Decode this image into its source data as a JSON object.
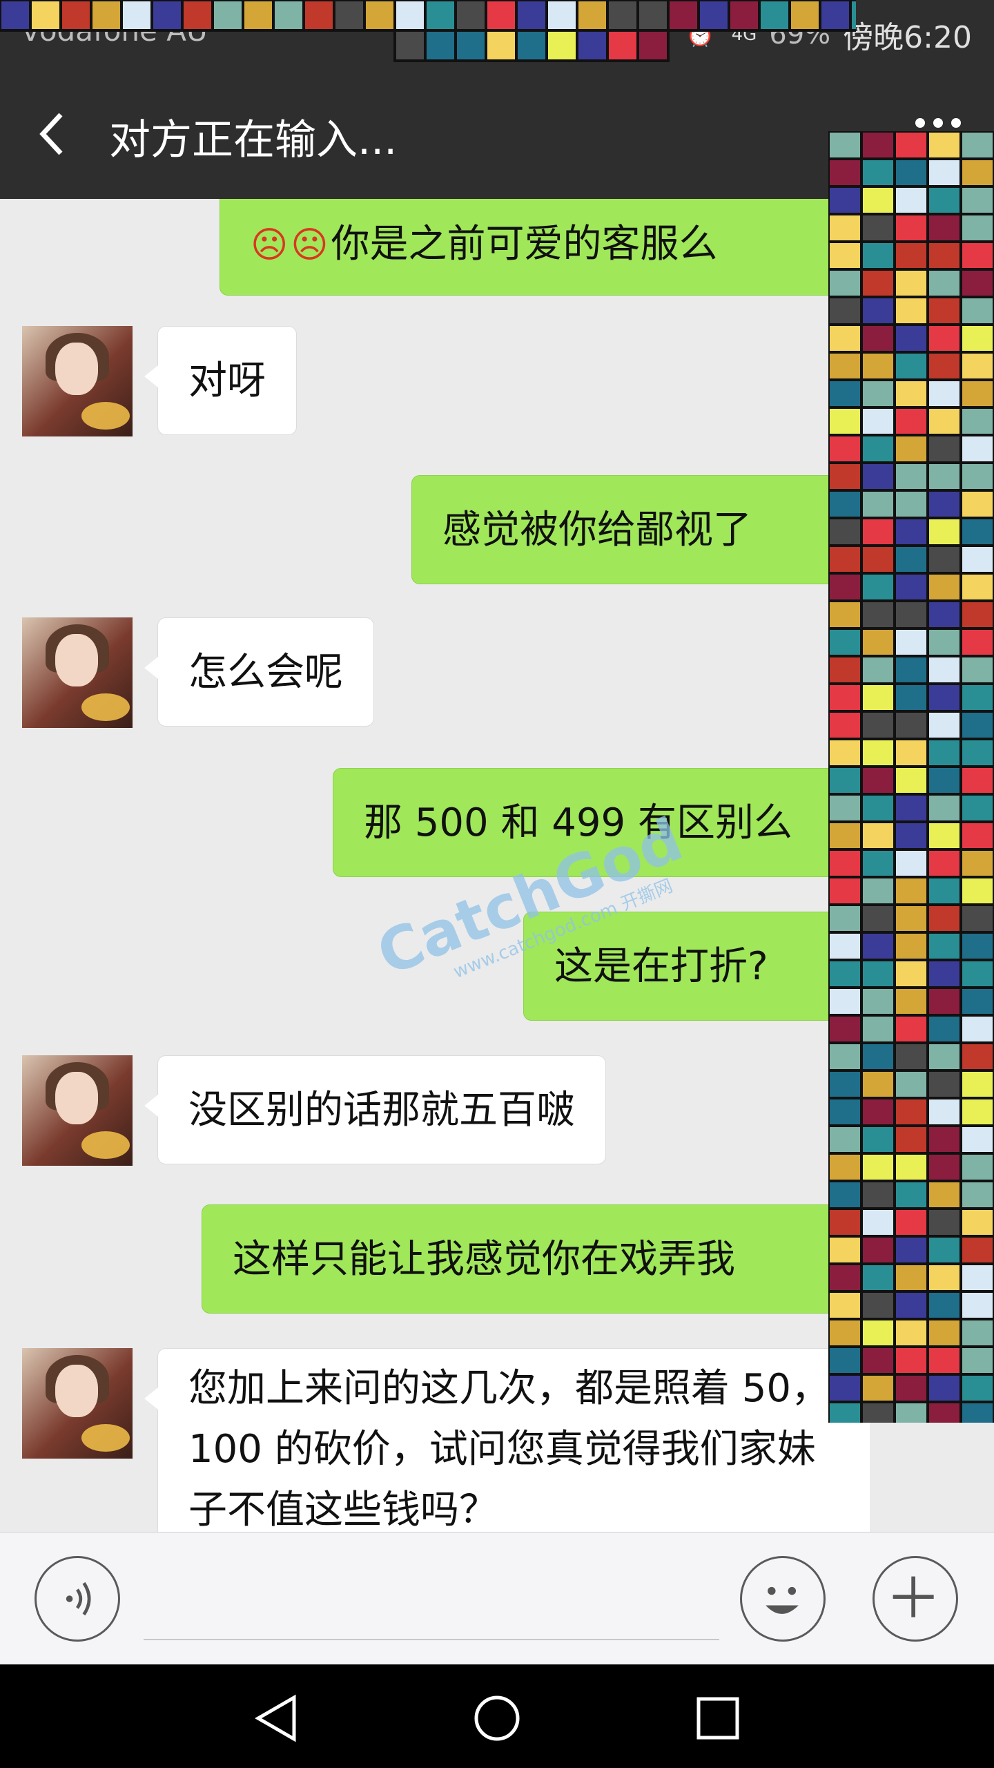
{
  "status_bar": {
    "carrier": "vodafone AU",
    "network": "4G",
    "battery": "69%",
    "time": "傍晚6:20"
  },
  "header": {
    "title": "对方正在输入...",
    "back_icon": "chevron-left-icon",
    "more_icon": "more-dots-icon"
  },
  "messages": [
    {
      "side": "right",
      "text": "你是之前可爱的客服么",
      "emoji_prefix": "angry-face-emoji x2"
    },
    {
      "side": "left",
      "text": "对呀"
    },
    {
      "side": "right",
      "text": "感觉被你给鄙视了"
    },
    {
      "side": "left",
      "text": "怎么会呢"
    },
    {
      "side": "right",
      "text": "那 500 和 499 有区别么"
    },
    {
      "side": "right",
      "text": "这是在打折?"
    },
    {
      "side": "left",
      "text": "没区别的话那就五百啵"
    },
    {
      "side": "right",
      "text": "这样只能让我感觉你在戏弄我"
    },
    {
      "side": "left",
      "text": "您加上来问的这几次，都是照着 50，100 的砍价，试问您真觉得我们家妹子不值这些钱吗？"
    }
  ],
  "watermark": {
    "brand": "CatchGod",
    "url": "www.catchgod.com 开撕网"
  },
  "input_bar": {
    "voice_icon": "voice-icon",
    "emoji_icon": "smiley-icon",
    "plus_icon": "plus-icon",
    "placeholder": ""
  },
  "system_nav": {
    "back_icon": "triangle-back-icon",
    "home_icon": "circle-home-icon",
    "recent_icon": "square-recent-icon"
  },
  "colors": {
    "header_bg": "#2e2e2e",
    "chat_bg": "#ebebeb",
    "sent_bubble": "#a0e75a",
    "received_bubble": "#ffffff"
  }
}
